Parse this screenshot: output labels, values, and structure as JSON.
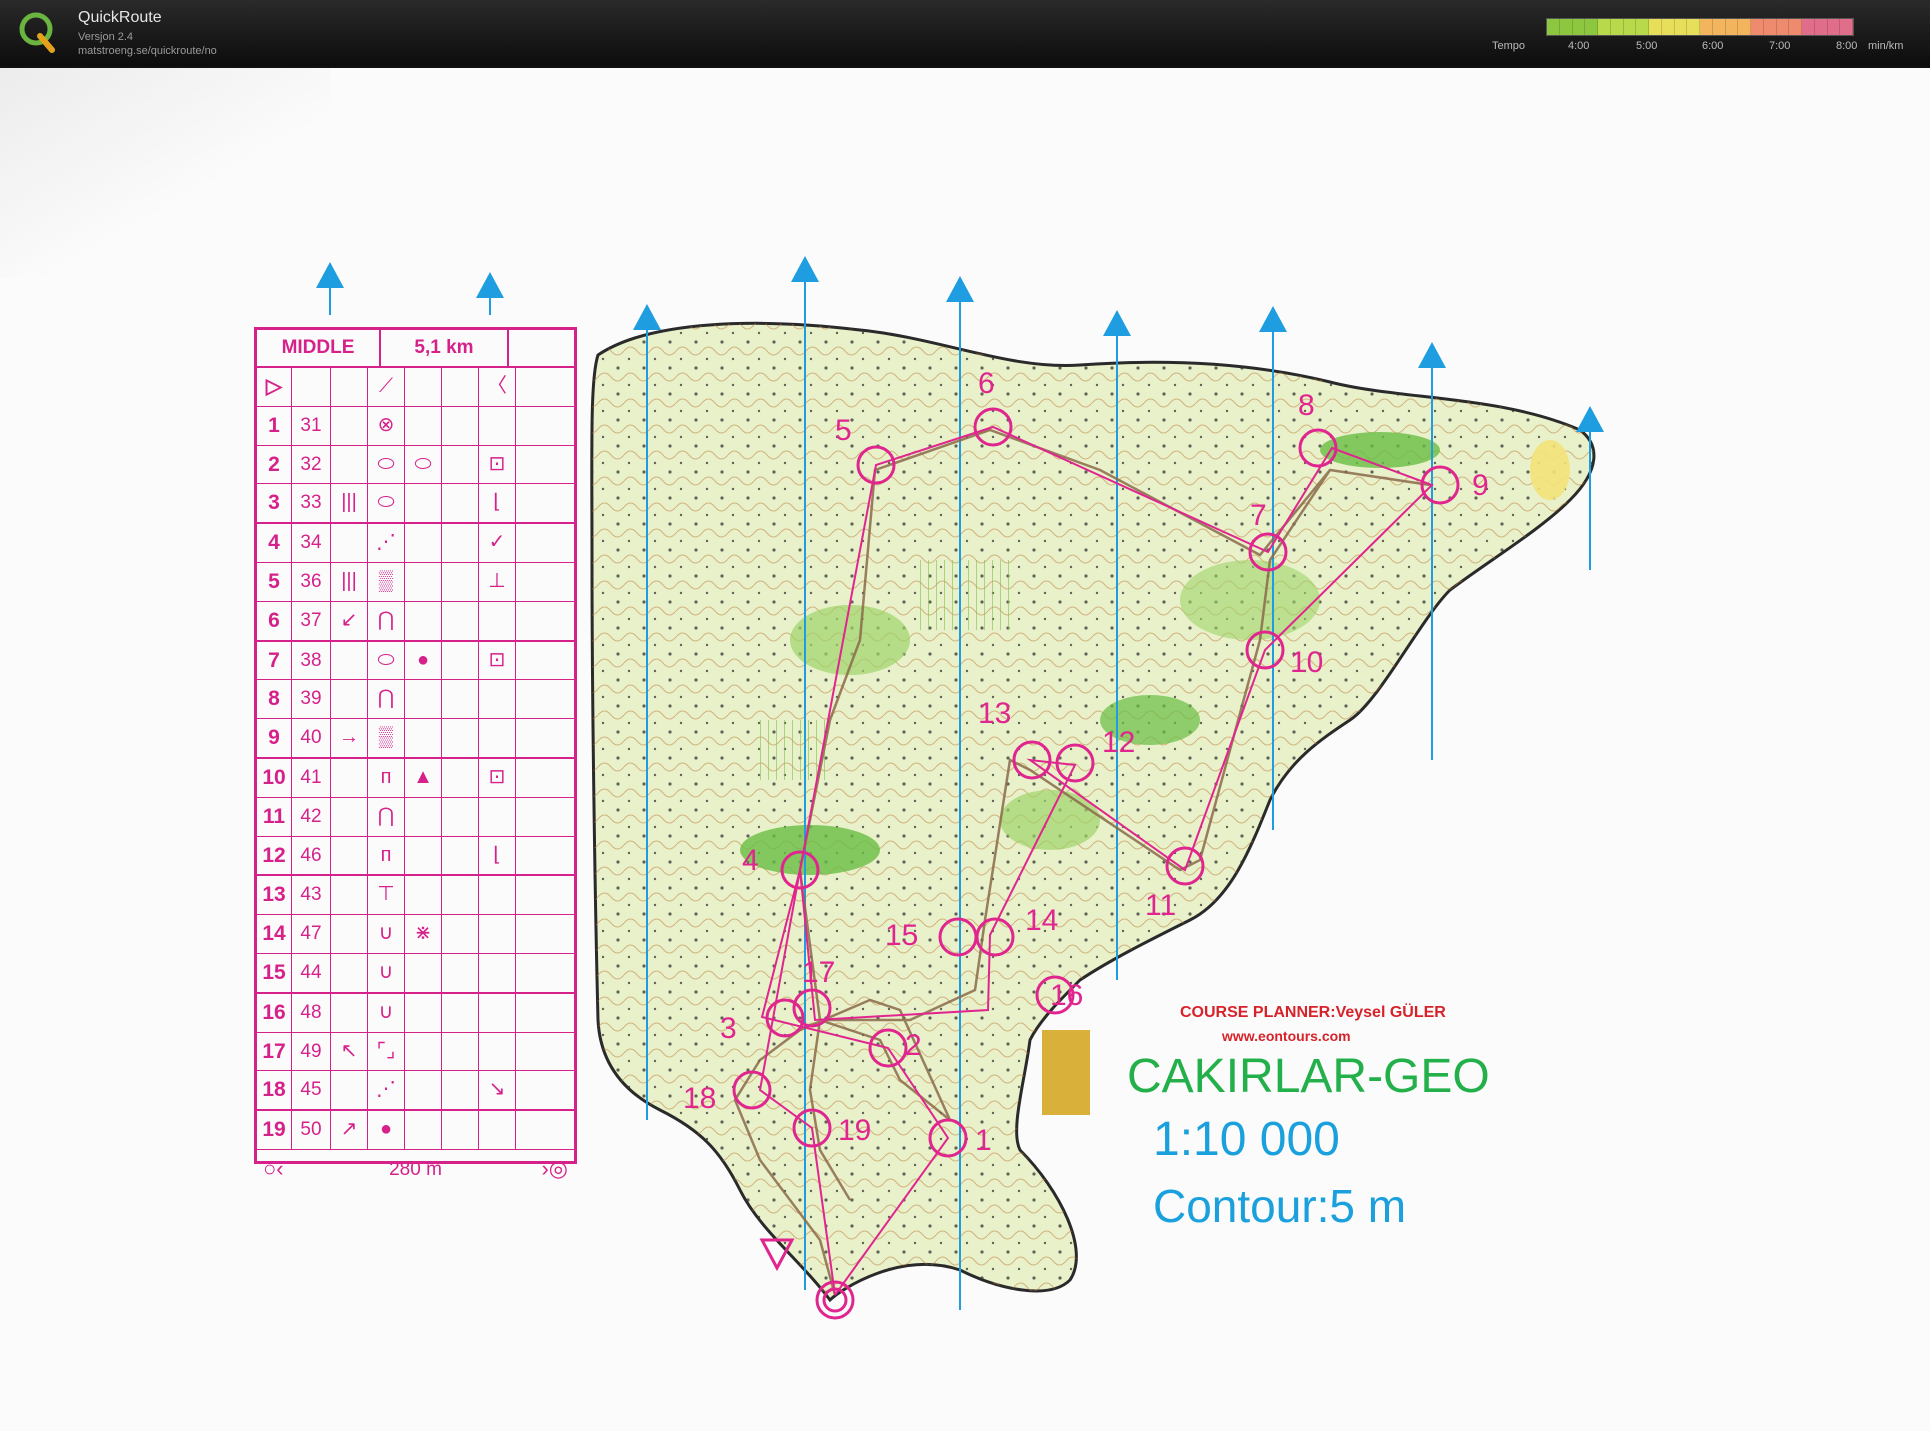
{
  "app": {
    "name": "QuickRoute",
    "version": "Versjon 2.4",
    "url": "matstroeng.se/quickroute/no",
    "logo_letter": "Q"
  },
  "tempo": {
    "label": "Tempo",
    "ticks": [
      "4:00",
      "5:00",
      "6:00",
      "7:00",
      "8:00"
    ],
    "unit": "min/km",
    "gradient_colors": [
      "#8dc63f",
      "#b8d94a",
      "#e7df5a",
      "#f2b45c",
      "#ee8a6d",
      "#e06d8a"
    ]
  },
  "description_sheet": {
    "event": "MIDDLE",
    "length": "5,1 km",
    "rows": [
      {
        "num": "1",
        "code": "31",
        "b1": "",
        "b2": "⊗",
        "b3": "",
        "b4": ""
      },
      {
        "num": "2",
        "code": "32",
        "b1": "",
        "b2": "⬭",
        "b3": "⬭",
        "b4": "⊡"
      },
      {
        "num": "3",
        "code": "33",
        "b1": "|||",
        "b2": "⬭",
        "b3": "",
        "b4": "⌊"
      },
      {
        "num": "4",
        "code": "34",
        "b1": "",
        "b2": "⋰",
        "b3": "",
        "b4": "✓"
      },
      {
        "num": "5",
        "code": "36",
        "b1": "|||",
        "b2": "▒",
        "b3": "",
        "b4": "⊥"
      },
      {
        "num": "6",
        "code": "37",
        "b1": "↙",
        "b2": "⋂",
        "b3": "",
        "b4": ""
      },
      {
        "num": "7",
        "code": "38",
        "b1": "",
        "b2": "⬭",
        "b3": "●",
        "b4": "⊡"
      },
      {
        "num": "8",
        "code": "39",
        "b1": "",
        "b2": "⋂",
        "b3": "",
        "b4": ""
      },
      {
        "num": "9",
        "code": "40",
        "b1": "→",
        "b2": "▒",
        "b3": "",
        "b4": ""
      },
      {
        "num": "10",
        "code": "41",
        "b1": "",
        "b2": "ᴨ",
        "b3": "▲",
        "b4": "⊡"
      },
      {
        "num": "11",
        "code": "42",
        "b1": "",
        "b2": "⋂",
        "b3": "",
        "b4": ""
      },
      {
        "num": "12",
        "code": "46",
        "b1": "",
        "b2": "ᴨ",
        "b3": "",
        "b4": "⌊"
      },
      {
        "num": "13",
        "code": "43",
        "b1": "",
        "b2": "⊤",
        "b3": "",
        "b4": ""
      },
      {
        "num": "14",
        "code": "47",
        "b1": "",
        "b2": "∪",
        "b3": "⋇",
        "b4": ""
      },
      {
        "num": "15",
        "code": "44",
        "b1": "",
        "b2": "∪",
        "b3": "",
        "b4": ""
      },
      {
        "num": "16",
        "code": "48",
        "b1": "",
        "b2": "∪",
        "b3": "",
        "b4": ""
      },
      {
        "num": "17",
        "code": "49",
        "b1": "↖",
        "b2": "⌜⌟",
        "b3": "",
        "b4": ""
      },
      {
        "num": "18",
        "code": "45",
        "b1": "",
        "b2": "⋰",
        "b3": "",
        "b4": "↘"
      },
      {
        "num": "19",
        "code": "50",
        "b1": "↗",
        "b2": "●",
        "b3": "",
        "b4": ""
      }
    ],
    "start_row": {
      "b2": "⟋",
      "b4": "〈"
    },
    "finish_distance": "280 m",
    "finish_left": "○‹",
    "finish_right": "›◎"
  },
  "map_info": {
    "planner": "COURSE PLANNER:Veysel GÜLER",
    "website": "www.eontours.com",
    "title": "CAKIRLAR-GEO",
    "scale": "1:10 000",
    "contour": "Contour:5 m"
  },
  "controls": [
    "1",
    "2",
    "3",
    "4",
    "5",
    "6",
    "7",
    "8",
    "9",
    "10",
    "11",
    "12",
    "13",
    "14",
    "15",
    "16",
    "17",
    "18",
    "19"
  ],
  "colors": {
    "course": "#e0258f",
    "north_lines": "#1e9ee0",
    "forest": "#cfe6a0",
    "green_dense": "#69bd45",
    "open_yellow": "#f4e27a",
    "contour": "#c07a3a",
    "title_green": "#23b04a",
    "scale_blue": "#1aa0dc",
    "planner_red": "#d8222a"
  }
}
